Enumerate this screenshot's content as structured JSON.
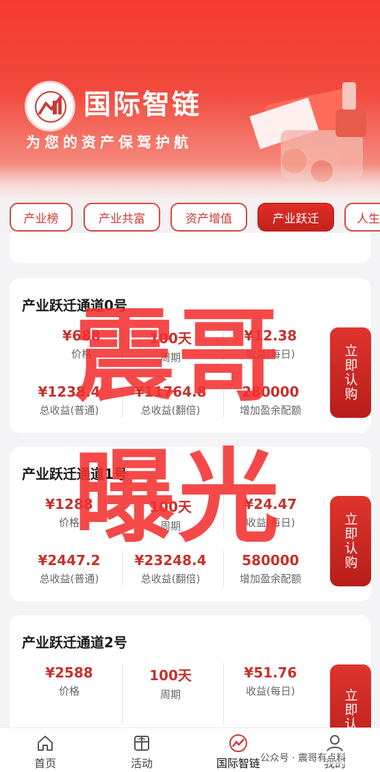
{
  "banner": {
    "brand_name": "国际智链",
    "slogan": "为您的资产保驾护航",
    "emblem_icon": "company-seal-logo"
  },
  "tabs": [
    {
      "label": "产业榜",
      "active": false
    },
    {
      "label": "产业共富",
      "active": false
    },
    {
      "label": "资产增值",
      "active": false
    },
    {
      "label": "产业跃迁",
      "active": true
    },
    {
      "label": "人生",
      "active": false
    }
  ],
  "cards": [
    {
      "title": "产业跃迁通道0号",
      "price": "¥688",
      "price_label": "价格",
      "period": "100天",
      "period_label": "周期",
      "daily": "¥12.38",
      "daily_label": "收益(每日)",
      "total_normal": "¥1238.4",
      "total_normal_label": "总收益(普通)",
      "total_double": "¥11764.8",
      "total_double_label": "总收益(翻倍)",
      "quota": "280000",
      "quota_label": "增加盈余配额",
      "button": "立即认购"
    },
    {
      "title": "产业跃迁通道1号",
      "price": "¥1288",
      "price_label": "价格",
      "period": "100天",
      "period_label": "周期",
      "daily": "¥24.47",
      "daily_label": "收益(每日)",
      "total_normal": "¥2447.2",
      "total_normal_label": "总收益(普通)",
      "total_double": "¥23248.4",
      "total_double_label": "总收益(翻倍)",
      "quota": "580000",
      "quota_label": "增加盈余配额",
      "button": "立即认购"
    },
    {
      "title": "产业跃迁通道2号",
      "price": "¥2588",
      "price_label": "价格",
      "period": "100天",
      "period_label": "周期",
      "daily": "¥51.76",
      "daily_label": "收益(每日)",
      "button": "立即认"
    }
  ],
  "watermark": {
    "line1": "震哥",
    "line2": "曝光"
  },
  "bottom_nav": [
    {
      "label": "首页",
      "icon": "home-icon",
      "active": false
    },
    {
      "label": "活动",
      "icon": "gift-icon",
      "active": false
    },
    {
      "label": "国际智链",
      "icon": "brand-logo-icon",
      "active": true
    },
    {
      "label": "我的",
      "icon": "user-icon",
      "active": false
    }
  ],
  "credit": "公众号 · 震哥有点料",
  "colors": {
    "primary_red": "#c5322c",
    "button_red": "#d02a24",
    "banner_red": "#f53a33"
  }
}
